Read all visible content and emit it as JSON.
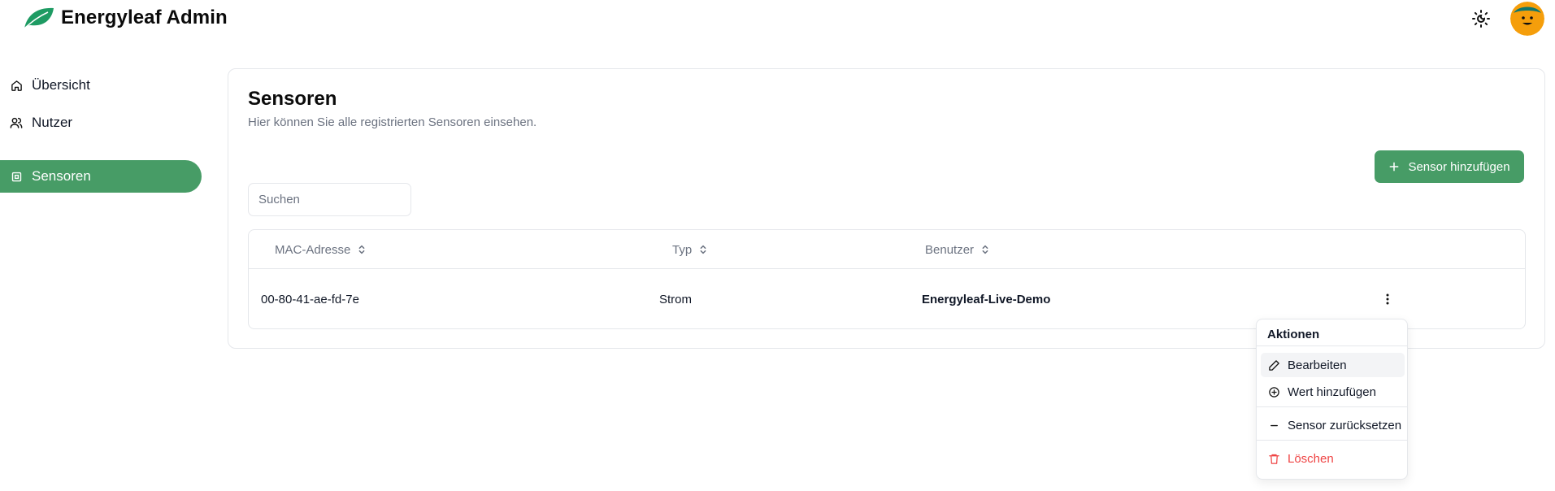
{
  "header": {
    "brand": "Energyleaf Admin",
    "logo_icon": "leaf-icon",
    "theme_icon": "sun-moon-icon",
    "avatar_icon": "smiley-avatar"
  },
  "sidebar": {
    "items": [
      {
        "label": "Übersicht",
        "icon": "home-icon"
      },
      {
        "label": "Nutzer",
        "icon": "users-icon"
      },
      {
        "label": "Sensoren",
        "icon": "cpu-icon",
        "active": true
      }
    ]
  },
  "main": {
    "title": "Sensoren",
    "subtitle": "Hier können Sie alle registrierten Sensoren einsehen.",
    "add_button_label": "Sensor hinzufügen",
    "search_placeholder": "Suchen",
    "table": {
      "columns": [
        "MAC-Adresse",
        "Typ",
        "Benutzer"
      ],
      "rows": [
        {
          "mac": "00-80-41-ae-fd-7e",
          "type": "Strom",
          "user": "Energyleaf-Live-Demo"
        }
      ]
    }
  },
  "actions_menu": {
    "title": "Aktionen",
    "items": [
      {
        "label": "Bearbeiten",
        "icon": "pencil-icon"
      },
      {
        "label": "Wert hinzufügen",
        "icon": "plus-circle-icon"
      },
      {
        "label": "Sensor zurücksetzen",
        "icon": "minus-icon"
      },
      {
        "label": "Löschen",
        "icon": "trash-icon"
      }
    ]
  },
  "colors": {
    "accent": "#479c66",
    "danger": "#ef4444",
    "muted_text": "#6b7280",
    "border": "#e5e7eb"
  }
}
